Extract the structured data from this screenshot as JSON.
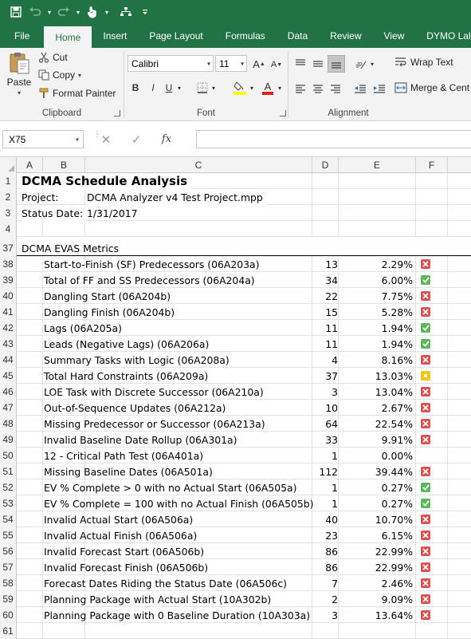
{
  "colors": {
    "excel_green": "#217346",
    "fail": "#d9534f",
    "pass": "#5cb85c",
    "warn": "#f5c518"
  },
  "quick_access": {
    "icons": [
      "save-icon",
      "undo-icon",
      "redo-icon",
      "touch-mode-icon",
      "org-chart-icon",
      "customize-qat-icon"
    ]
  },
  "ribbon_tabs": [
    "File",
    "Home",
    "Insert",
    "Page Layout",
    "Formulas",
    "Data",
    "Review",
    "View",
    "DYMO Lal"
  ],
  "ribbon": {
    "clipboard": {
      "label": "Clipboard",
      "paste": "Paste",
      "cut": "Cut",
      "copy": "Copy",
      "format_painter": "Format Painter"
    },
    "font": {
      "label": "Font",
      "family": "Calibri",
      "size": "11",
      "bold": "B",
      "italic": "I",
      "underline": "U"
    },
    "alignment": {
      "label": "Alignment",
      "wrap_text": "Wrap Text",
      "merge": "Merge & Cent"
    }
  },
  "formula_bar": {
    "name_box": "X75",
    "fx": "fx",
    "formula": ""
  },
  "columns": [
    "A",
    "B",
    "C",
    "D",
    "E",
    "F"
  ],
  "header_rows": [
    {
      "row": "1",
      "text": "DCMA Schedule Analysis"
    },
    {
      "row": "2",
      "label": "Project:",
      "value": "DCMA Analyzer v4 Test Project.mpp"
    },
    {
      "row": "3",
      "label": "Status Date:",
      "value": "1/31/2017"
    },
    {
      "row": "4"
    },
    {
      "row": "37",
      "text": "DCMA EVAS Metrics"
    }
  ],
  "metrics": [
    {
      "row": "38",
      "name": "Start-to-Finish (SF) Predecessors (06A203a)",
      "count": "13",
      "pct": "2.29%",
      "status": "fail"
    },
    {
      "row": "39",
      "name": "Total of FF and SS Predecessors (06A204a)",
      "count": "34",
      "pct": "6.00%",
      "status": "pass"
    },
    {
      "row": "40",
      "name": "Dangling Start (06A204b)",
      "count": "22",
      "pct": "7.75%",
      "status": "fail"
    },
    {
      "row": "41",
      "name": "Dangling Finish (06A204b)",
      "count": "15",
      "pct": "5.28%",
      "status": "fail"
    },
    {
      "row": "42",
      "name": "Lags (06A205a)",
      "count": "11",
      "pct": "1.94%",
      "status": "pass"
    },
    {
      "row": "43",
      "name": "Leads (Negative Lags) (06A206a)",
      "count": "11",
      "pct": "1.94%",
      "status": "pass"
    },
    {
      "row": "44",
      "name": "Summary Tasks with Logic (06A208a)",
      "count": "4",
      "pct": "8.16%",
      "status": "fail"
    },
    {
      "row": "45",
      "name": "Total Hard Constraints (06A209a)",
      "count": "37",
      "pct": "13.03%",
      "status": "warn"
    },
    {
      "row": "46",
      "name": "LOE Task with Discrete Successor (06A210a)",
      "count": "3",
      "pct": "13.04%",
      "status": "fail"
    },
    {
      "row": "47",
      "name": "Out-of-Sequence Updates (06A212a)",
      "count": "10",
      "pct": "2.67%",
      "status": "fail"
    },
    {
      "row": "48",
      "name": "Missing Predecessor or Successor (06A213a)",
      "count": "64",
      "pct": "22.54%",
      "status": "fail"
    },
    {
      "row": "49",
      "name": "Invalid Baseline Date Rollup (06A301a)",
      "count": "33",
      "pct": "9.91%",
      "status": "fail"
    },
    {
      "row": "50",
      "name": "12 - Critical Path Test (06A401a)",
      "count": "1",
      "pct": "0.00%",
      "status": "none"
    },
    {
      "row": "51",
      "name": "Missing Baseline Dates (06A501a)",
      "count": "112",
      "pct": "39.44%",
      "status": "fail"
    },
    {
      "row": "52",
      "name": "EV % Complete > 0 with no Actual Start (06A505a)",
      "count": "1",
      "pct": "0.27%",
      "status": "pass"
    },
    {
      "row": "53",
      "name": "EV % Complete = 100 with no Actual Finish (06A505b)",
      "count": "1",
      "pct": "0.27%",
      "status": "pass"
    },
    {
      "row": "54",
      "name": "Invalid Actual Start (06A506a)",
      "count": "40",
      "pct": "10.70%",
      "status": "fail"
    },
    {
      "row": "55",
      "name": "Invalid Actual Finish (06A506a)",
      "count": "23",
      "pct": "6.15%",
      "status": "fail"
    },
    {
      "row": "56",
      "name": "Invalid Forecast Start (06A506b)",
      "count": "86",
      "pct": "22.99%",
      "status": "fail"
    },
    {
      "row": "57",
      "name": "Invalid Forecast Finish (06A506b)",
      "count": "86",
      "pct": "22.99%",
      "status": "fail"
    },
    {
      "row": "58",
      "name": "Forecast Dates Riding the Status Date (06A506c)",
      "count": "7",
      "pct": "2.46%",
      "status": "fail"
    },
    {
      "row": "59",
      "name": "Planning Package with Actual Start (10A302b)",
      "count": "2",
      "pct": "9.09%",
      "status": "fail"
    },
    {
      "row": "60",
      "name": "Planning Package with 0 Baseline Duration (10A303a)",
      "count": "3",
      "pct": "13.64%",
      "status": "fail"
    }
  ],
  "trailing_rows": [
    "61"
  ]
}
